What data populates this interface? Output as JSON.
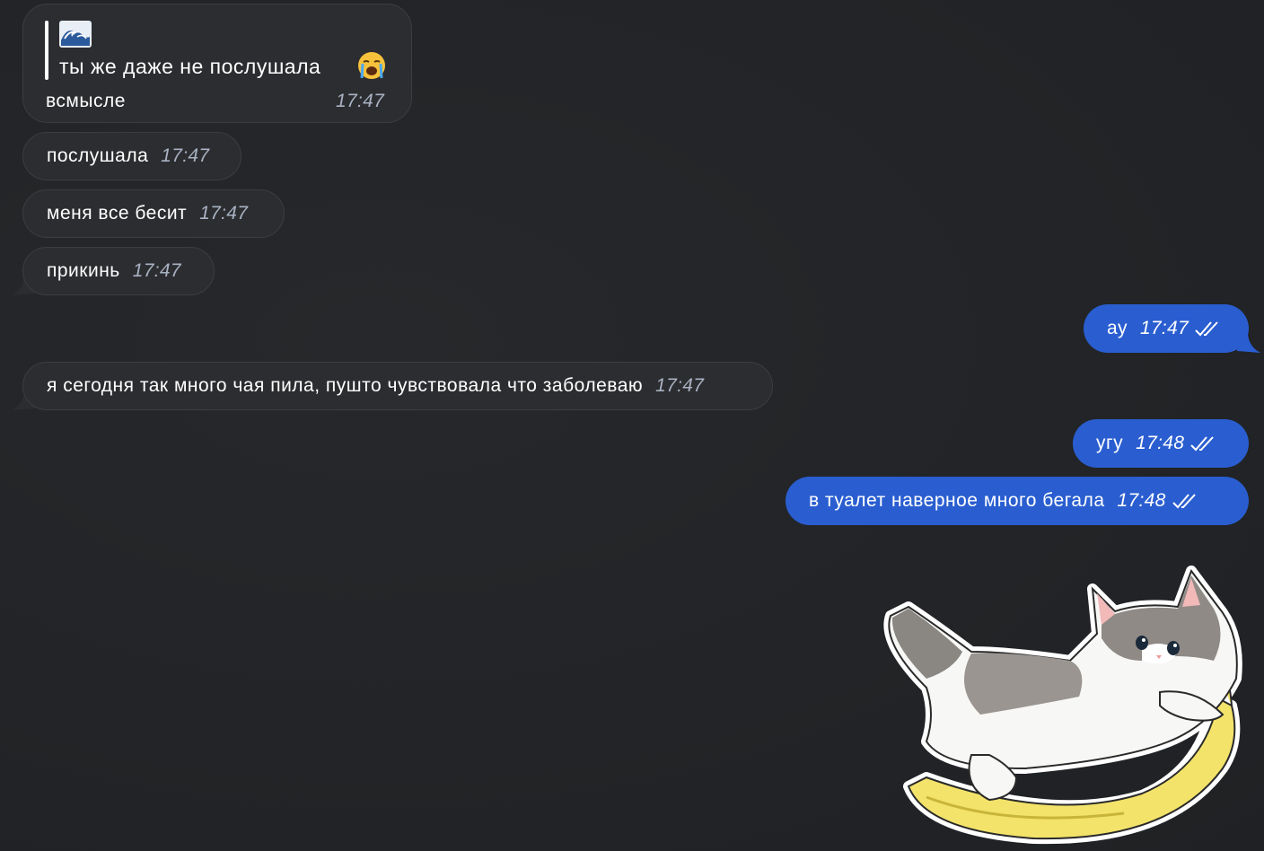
{
  "messages": [
    {
      "direction": "incoming",
      "quote": {
        "emoji": "wave-emoji",
        "text": "ты же даже не послушала",
        "trailing_emoji": "crying-face-emoji"
      },
      "text": "всмысле",
      "time": "17:47"
    },
    {
      "direction": "incoming",
      "text": "послушала",
      "time": "17:47"
    },
    {
      "direction": "incoming",
      "text": "меня все бесит",
      "time": "17:47"
    },
    {
      "direction": "incoming",
      "text": "прикинь",
      "time": "17:47"
    },
    {
      "direction": "outgoing",
      "text": "ау",
      "time": "17:47",
      "status": "read"
    },
    {
      "direction": "incoming",
      "text": "я сегодня так много чая пила, пушто чувствовала что заболеваю",
      "time": "17:47"
    },
    {
      "direction": "outgoing",
      "text": "угу",
      "time": "17:48",
      "status": "read"
    },
    {
      "direction": "outgoing",
      "text": "в туалет наверное много бегала",
      "time": "17:48",
      "status": "read"
    }
  ],
  "sticker": {
    "icon": "cat-on-banana-sticker"
  },
  "colors": {
    "background": "#222427",
    "incoming_bubble": "#2c2d30",
    "outgoing_bubble": "#2a5ed0",
    "time_incoming": "#a9b2c3"
  }
}
